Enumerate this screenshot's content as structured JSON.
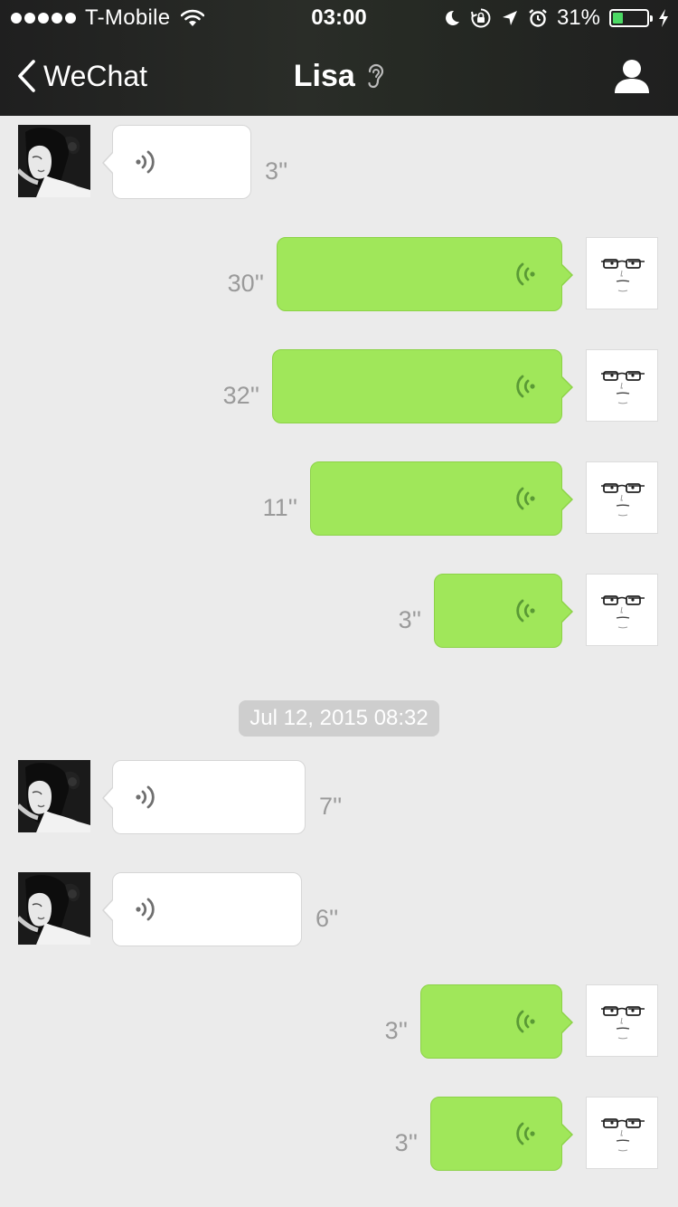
{
  "status_bar": {
    "carrier": "T-Mobile",
    "signal_bars": 5,
    "time": "03:00",
    "battery_percent": "31%",
    "battery_level": 0.31,
    "battery_color": "#4cd964",
    "icons": [
      "signal-dots-icon",
      "wifi-icon",
      "moon-icon",
      "rotation-lock-icon",
      "location-arrow-icon",
      "alarm-icon",
      "battery-icon",
      "charging-bolt-icon"
    ]
  },
  "nav": {
    "back_label": "WeChat",
    "title": "Lisa",
    "title_icon": "ear-icon",
    "right_icon": "profile-icon"
  },
  "colors": {
    "header_bg": "#262a24",
    "chat_bg": "#ebebeb",
    "outgoing_bubble": "#a0e75a",
    "incoming_bubble": "#ffffff",
    "duration_text": "#9a9a9a",
    "timestamp_bg": "#cecece"
  },
  "timestamp": "Jul 12, 2015 08:32",
  "messages": [
    {
      "direction": "incoming",
      "type": "voice",
      "duration": "3''"
    },
    {
      "direction": "outgoing",
      "type": "voice",
      "duration": "30''"
    },
    {
      "direction": "outgoing",
      "type": "voice",
      "duration": "32''"
    },
    {
      "direction": "outgoing",
      "type": "voice",
      "duration": "11''"
    },
    {
      "direction": "outgoing",
      "type": "voice",
      "duration": "3''"
    },
    {
      "direction": "incoming",
      "type": "voice",
      "duration": "7''"
    },
    {
      "direction": "incoming",
      "type": "voice",
      "duration": "6''"
    },
    {
      "direction": "outgoing",
      "type": "voice",
      "duration": "3''"
    },
    {
      "direction": "outgoing",
      "type": "voice",
      "duration": "3''"
    }
  ]
}
